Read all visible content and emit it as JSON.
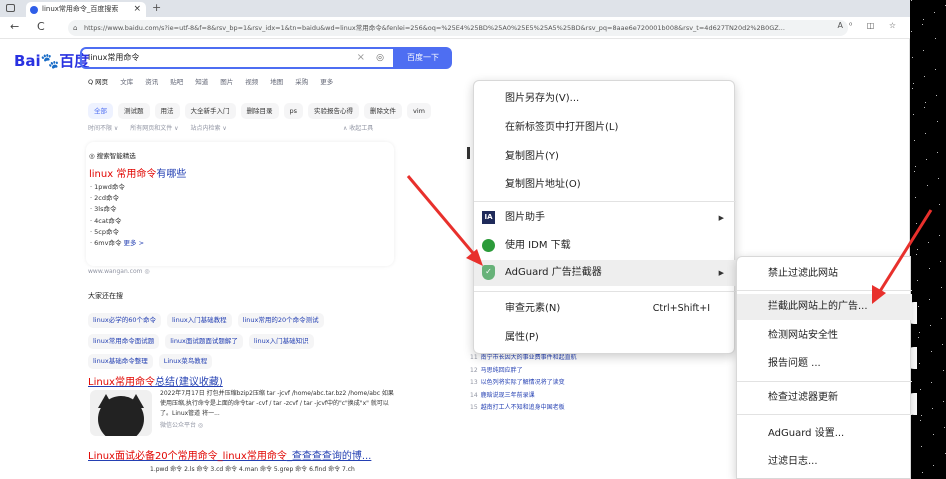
{
  "browser": {
    "tab_title": "linux常用命令_百度搜索",
    "tab_close": "×",
    "new_tab": "+",
    "url": "https://www.baidu.com/s?ie=utf-8&f=8&rsv_bp=1&rsv_idx=1&tn=baidu&wd=linux常用命令&fenlei=256&oq=%25E4%25BD%25A0%25E5%25A5%25BD&rsv_pq=8aae6e720001b008&rsv_t=4d627TN20d2%2B0GZ...",
    "back": "←",
    "reload": "C",
    "lock": "⌂",
    "toolbar_icons": "A⁰ ◫ ☆"
  },
  "baidu": {
    "logo_left": "Bai",
    "logo_paw": "🐾",
    "logo_right": "百度",
    "query": "linux常用命令",
    "clear": "×",
    "camera": "◎",
    "search_button": "百度一下",
    "tabs": [
      "Q 网页",
      "文库",
      "资讯",
      "贴吧",
      "知道",
      "图片",
      "视频",
      "地图",
      "采购",
      "更多"
    ],
    "filters": [
      "全部",
      "测试题",
      "用法",
      "大全新手入门",
      "删除目录",
      "ps",
      "实验报告心得",
      "删除文件",
      "vim"
    ],
    "tools": [
      "时间不限 ∨",
      "所有网页和文件 ∨",
      "站点内检索 ∨"
    ],
    "tools_right": "∧ 收起工具",
    "card": {
      "label": "◎ 搜索智能精选",
      "title_red": "linux 常用命令",
      "title_rest": "有哪些",
      "items": [
        "· 1pwd命令",
        "· 2cd命令",
        "· 3ls命令",
        "· 4cat命令",
        "· 5cp命令",
        "· 6mv命令"
      ],
      "more": "更多 >"
    },
    "source": "www.wangan.com ◎",
    "also_search": "大家还在搜",
    "related_row1": [
      "linux必学的60个命令",
      "linux入门基础教程",
      "linux常用的20个命令测试"
    ],
    "related_row2": [
      "linux常用命令面试题",
      "linux面试题面试题解了",
      "linux入门基础知识"
    ],
    "related_row3": [
      "linux基础命令整理",
      "Linux菜鸟教程"
    ],
    "result1_red": "Linux常用命令",
    "result1_rest": "总结(建议收藏)",
    "result1_snip": "2022年7月17日  打包并压缩bzip2压缩 tar -jcvf /home/abc.tar.bz2 /home/abc 如果使用压缩,执行命令是上面的命令tar -cvf / tar -zcvf / tar -jcvf中的\"c\"换成\"x\" 就可以了。Linux管道 将一...",
    "result1_src": "微信公众平台 ◎",
    "result2_red": "Linux面试必备20个常用命令_linux常用命令",
    "result2_rest": "_查查查查询的博...",
    "result2_snip": "1.pwd 命令 2.ls 命令 3.cd 命令 4.man 命令 5.grep 命令 6.find 命令 7.ch"
  },
  "hot": [
    {
      "n": "11",
      "t": "南宁市长因大的事业费事件和起直航"
    },
    {
      "n": "12",
      "t": "马思纯回应胖了"
    },
    {
      "n": "13",
      "t": "以色列将实际了解情况将了读变"
    },
    {
      "n": "14",
      "t": "鹿晗说现三年前录课"
    },
    {
      "n": "15",
      "t": "越南打工人不知和追身中国老板"
    }
  ],
  "context_menu": {
    "save_image": "图片另存为(V)...",
    "open_image_tab": "在新标签页中打开图片(L)",
    "copy_image": "复制图片(Y)",
    "copy_image_link": "复制图片地址(O)",
    "image_helper": "图片助手",
    "image_helper_badge": "IA",
    "idm_download": "使用 IDM 下载",
    "adguard": "AdGuard 广告拦截器",
    "inspect": "审查元素(N)",
    "inspect_shortcut": "Ctrl+Shift+I",
    "properties": "属性(P)",
    "arrow": "▶"
  },
  "submenu": {
    "items": [
      "禁止过滤此网站",
      "拦截此网站上的广告...",
      "检测网站安全性",
      "报告问题 ...",
      "检查过滤器更新",
      "AdGuard 设置...",
      "过滤日志..."
    ]
  },
  "colors": {
    "accent": "#4e6ef2",
    "link": "#2440b3",
    "highlight": "#e10602",
    "annotation": "#e8302c"
  }
}
